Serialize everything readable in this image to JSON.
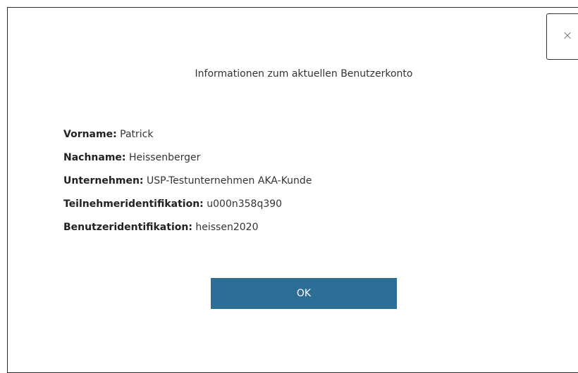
{
  "dialog": {
    "title": "Informationen zum aktuellen Benutzerkonto",
    "close_icon": "×",
    "fields": [
      {
        "label": "Vorname:",
        "value": "Patrick"
      },
      {
        "label": "Nachname:",
        "value": "Heissenberger"
      },
      {
        "label": "Unternehmen:",
        "value": "USP-Testunternehmen AKA-Kunde"
      },
      {
        "label": "Teilnehmeridentifikation:",
        "value": "u000n358q390"
      },
      {
        "label": "Benutzeridentifikation:",
        "value": "heissen2020"
      }
    ],
    "ok_label": "OK"
  },
  "colors": {
    "primary_button": "#2c6e95",
    "text": "#333333",
    "border": "#2b2b2b"
  }
}
